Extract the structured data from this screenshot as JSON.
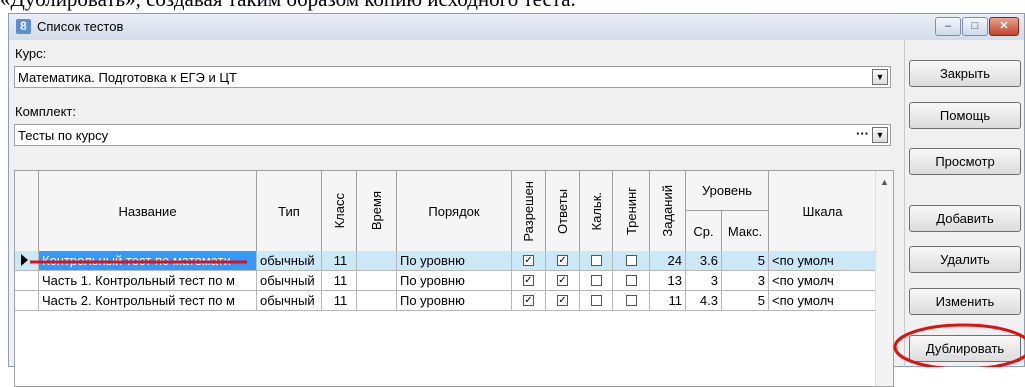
{
  "doc_fragment": "«Дублировать», создавая таким образом копию исходного теста.",
  "window": {
    "title": "Список тестов",
    "app_icon": "8",
    "minimize": "–",
    "maximize": "□",
    "close": "✕"
  },
  "course": {
    "label": "Курс:",
    "value": "Математика. Подготовка к ЕГЭ и ЦТ"
  },
  "kit": {
    "label": "Комплект:",
    "value": "Тесты по курсу",
    "ellipsis": "···"
  },
  "buttons": {
    "close": "Закрыть",
    "help": "Помощь",
    "view": "Просмотр",
    "add": "Добавить",
    "delete": "Удалить",
    "edit": "Изменить",
    "duplicate": "Дублировать"
  },
  "table": {
    "headers": {
      "name": "Название",
      "type": "Тип",
      "grade": "Класс",
      "time": "Время",
      "order": "Порядок",
      "allowed": "Разрешен",
      "answers": "Ответы",
      "calc": "Кальк.",
      "training": "Тренинг",
      "tasks": "Заданий",
      "level": "Уровень",
      "level_avg": "Ср.",
      "level_max": "Макс.",
      "scale": "Шкала"
    },
    "rows": [
      {
        "name": "Контрольный тест по математи",
        "type": "обычный",
        "grade": "11",
        "time": "",
        "order": "По уровню",
        "allowed": true,
        "answers": true,
        "calc": false,
        "training": false,
        "tasks": "24",
        "avg": "3.6",
        "max": "5",
        "scale": "<по умолч"
      },
      {
        "name": "Часть 1. Контрольный тест по м",
        "type": "обычный",
        "grade": "11",
        "time": "",
        "order": "По уровню",
        "allowed": true,
        "answers": true,
        "calc": false,
        "training": false,
        "tasks": "13",
        "avg": "3",
        "max": "3",
        "scale": "<по умолч"
      },
      {
        "name": "Часть 2. Контрольный тест по м",
        "type": "обычный",
        "grade": "11",
        "time": "",
        "order": "По уровню",
        "allowed": true,
        "answers": true,
        "calc": false,
        "training": false,
        "tasks": "11",
        "avg": "4.3",
        "max": "5",
        "scale": "<по умолч"
      }
    ]
  },
  "colors": {
    "selection": "#cbe8f6",
    "highlight_red": "#e01010"
  }
}
